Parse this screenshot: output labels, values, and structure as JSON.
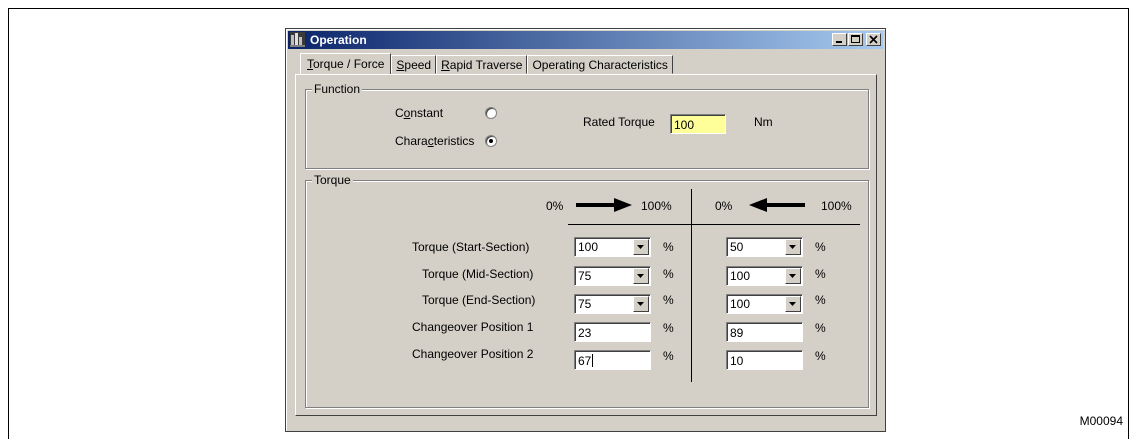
{
  "figure_id": "M00094",
  "window": {
    "title": "Operation",
    "controls": [
      "minimize",
      "maximize",
      "close"
    ]
  },
  "tabs": [
    {
      "label": "Torque / Force",
      "mnemonic": "T",
      "active": true
    },
    {
      "label": "Speed",
      "mnemonic": "S",
      "active": false
    },
    {
      "label": "Rapid Traverse",
      "mnemonic": "R",
      "active": false
    },
    {
      "label": "Operating Characteristics",
      "active": false
    }
  ],
  "function_group": {
    "title": "Function",
    "constant_label": "Constant",
    "characteristics_label": "Characteristics",
    "selected": "characteristics",
    "rated_torque_label": "Rated Torque",
    "rated_torque_value": "100",
    "rated_torque_unit": "Nm"
  },
  "torque_group": {
    "title": "Torque",
    "left_header": {
      "from": "0%",
      "to": "100%"
    },
    "right_header": {
      "from": "0%",
      "to": "100%"
    },
    "unit": "%",
    "rows": [
      {
        "label": "Torque (Start-Section)",
        "left": "100",
        "right": "50",
        "kind": "combo"
      },
      {
        "label": "Torque (Mid-Section)",
        "left": "75",
        "right": "100",
        "kind": "combo"
      },
      {
        "label": "Torque (End-Section)",
        "left": "75",
        "right": "100",
        "kind": "combo"
      },
      {
        "label": "Changeover Position 1",
        "left": "23",
        "right": "89",
        "kind": "text"
      },
      {
        "label": "Changeover Position 2",
        "left": "67",
        "right": "10",
        "kind": "text"
      }
    ]
  },
  "colors": {
    "title_gradient_start": "#0a246a",
    "title_gradient_end": "#a6caf0",
    "highlight_field": "#ffff99",
    "dialog_face": "#d4d0c8"
  }
}
